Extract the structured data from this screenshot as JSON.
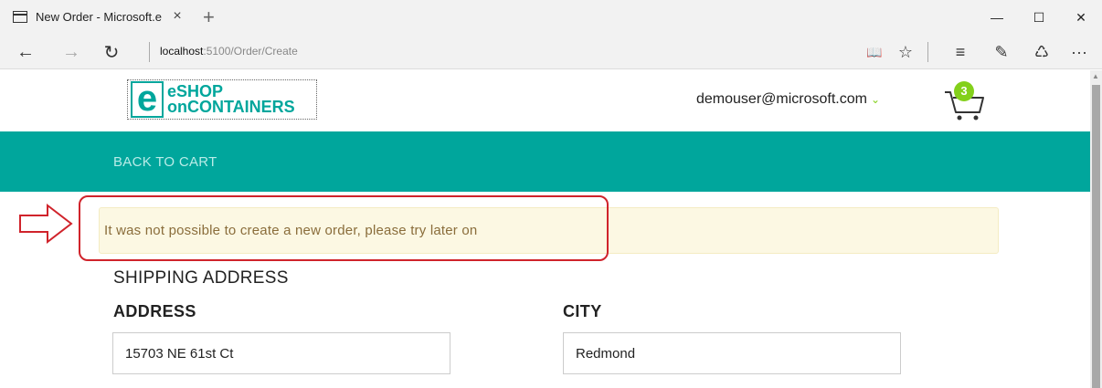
{
  "window": {
    "tab_title": "New Order - Microsoft.e",
    "tab_close": "×",
    "new_tab": "+",
    "minimize": "—",
    "maximize": "☐",
    "close": "✕"
  },
  "addressbar": {
    "host": "localhost",
    "path": ":5100/Order/Create",
    "back": "←",
    "forward": "→",
    "refresh": "↻"
  },
  "toolbar": {
    "reading_view": "📖",
    "favorite": "☆",
    "hub": "≡",
    "web_note": "✎",
    "share": "♺",
    "more": "···"
  },
  "header": {
    "logo_line1": "eSHOP",
    "logo_line2": "onCONTAINERS",
    "logo_letter": "e",
    "user_email": "demouser@microsoft.com",
    "user_chevron": "⌄",
    "cart_count": "3"
  },
  "nav": {
    "back_to_cart": "BACK TO CART"
  },
  "alert": {
    "message": "It was not possible to create a new order, please try later on"
  },
  "form": {
    "section_title": "SHIPPING ADDRESS",
    "address_label": "ADDRESS",
    "address_value": "15703 NE 61st Ct",
    "city_label": "CITY",
    "city_value": "Redmond"
  },
  "colors": {
    "brand": "#00a69c",
    "badge": "#83d01b",
    "alert_bg": "#fcf8e3",
    "alert_text": "#8a6d3b",
    "callout": "#d0232b"
  }
}
